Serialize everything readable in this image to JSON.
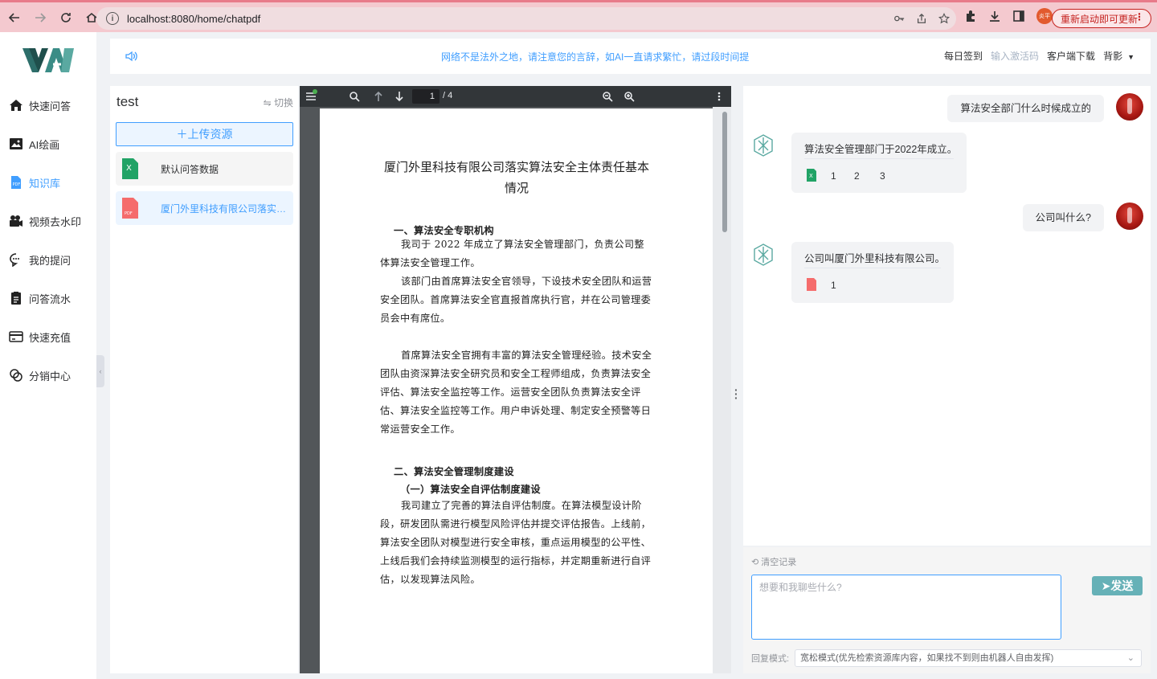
{
  "browser": {
    "url": "localhost:8080/home/chatpdf",
    "profile_label": "炎平",
    "update_label": "重新启动即可更新"
  },
  "sidebar": {
    "items": [
      {
        "label": "快速问答",
        "icon": "home-icon"
      },
      {
        "label": "AI绘画",
        "icon": "image-icon"
      },
      {
        "label": "知识库",
        "icon": "pdf-icon",
        "active": true
      },
      {
        "label": "视频去水印",
        "icon": "video-camera-icon"
      },
      {
        "label": "我的提问",
        "icon": "chat-bubble-icon"
      },
      {
        "label": "问答流水",
        "icon": "clipboard-icon"
      },
      {
        "label": "快速充值",
        "icon": "credit-card-icon"
      },
      {
        "label": "分销中心",
        "icon": "share-icon"
      }
    ]
  },
  "header": {
    "notice": "网络不是法外之地，请注意您的言辞，如AI一直请求繁忙，请过段时间提",
    "links": {
      "checkin": "每日签到",
      "activation": "输入激活码",
      "download": "客户端下载",
      "user": "背影"
    }
  },
  "files": {
    "title": "test",
    "switch_label": "切换",
    "upload_label": "上传资源",
    "items": [
      {
        "name": "默认问答数据",
        "type": "excel"
      },
      {
        "name": "厦门外里科技有限公司落实算法安全主体责任基本情况",
        "type": "pdf",
        "active": true
      }
    ]
  },
  "pdf": {
    "page_current": "1",
    "page_total": "/ 4",
    "title": "厦门外里科技有限公司落实算法安全主体责任基本情况",
    "section1": "一、算法安全专职机构",
    "para1": "我司于 2022 年成立了算法安全管理部门，负责公司整体算法安全管理工作。",
    "para2": "该部门由首席算法安全官领导，下设技术安全团队和运营安全团队。首席算法安全官直报首席执行官，并在公司管理委员会中有席位。",
    "para3": "首席算法安全官拥有丰富的算法安全管理经验。技术安全团队由资深算法安全研究员和安全工程师组成，负责算法安全评估、算法安全监控等工作。运营安全团队负责算法安全评估、算法安全监控等工作。用户申诉处理、制定安全预警等日常运营安全工作。",
    "section2": "二、算法安全管理制度建设",
    "section2_1": "（一）算法安全自评估制度建设",
    "para4": "我司建立了完善的算法自评估制度。在算法模型设计阶段，研发团队需进行模型风险评估并提交评估报告。上线前，算法安全团队对模型进行安全审核，重点运用模型的公平性、上线后我们会持续监测模型的运行指标，并定期重新进行自评估，以发现算法风险。"
  },
  "chat": {
    "messages": [
      {
        "role": "user",
        "text": "算法安全部门什么时候成立的"
      },
      {
        "role": "bot",
        "text": "算法安全管理部门于2022年成立。",
        "ref_type": "excel",
        "refs": [
          "1",
          "2",
          "3"
        ]
      },
      {
        "role": "user",
        "text": "公司叫什么?"
      },
      {
        "role": "bot",
        "text": "公司叫厦门外里科技有限公司。",
        "ref_type": "pdf",
        "refs": [
          "1"
        ]
      }
    ],
    "clear_label": "清空记录",
    "input_placeholder": "想要和我聊些什么?",
    "send_label": "发送",
    "mode_label": "回复模式:",
    "mode_value": "宽松模式(优先检索资源库内容，如果找不到则由机器人自由发挥)"
  },
  "colors": {
    "accent": "#409eff",
    "send": "#66b1b7"
  }
}
